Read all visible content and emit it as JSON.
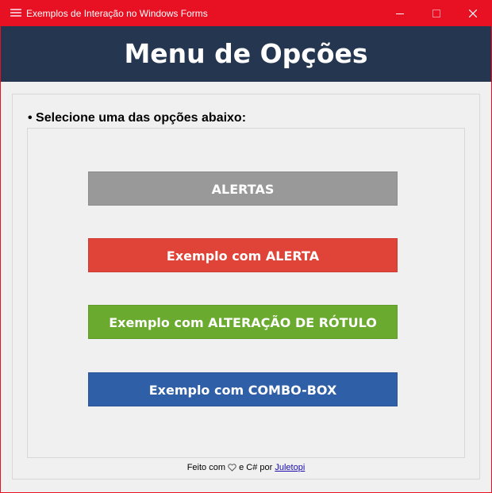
{
  "window": {
    "title": "Exemplos de Interação no Windows Forms",
    "accent_color": "#e81123",
    "icon": "app-list-icon"
  },
  "titlebar_buttons": {
    "minimize_icon": "minimize-icon",
    "maximize_icon": "maximize-icon",
    "close_icon": "close-icon"
  },
  "header": {
    "title": "Menu de Opções",
    "background": "#253650"
  },
  "main": {
    "prompt": "• Selecione uma das opções abaixo:",
    "buttons": [
      {
        "label": "ALERTAS",
        "color": "#999999"
      },
      {
        "label": "Exemplo com ALERTA",
        "color": "#e04338"
      },
      {
        "label": "Exemplo com ALTERAÇÃO DE RÓTULO",
        "color": "#6aaa2e"
      },
      {
        "label": "Exemplo com COMBO-BOX",
        "color": "#2f5fa6"
      }
    ]
  },
  "footer": {
    "prefix": "Feito com",
    "heart_icon": "heart-icon",
    "middle": "e C# por",
    "author_link": "Juletopi"
  }
}
